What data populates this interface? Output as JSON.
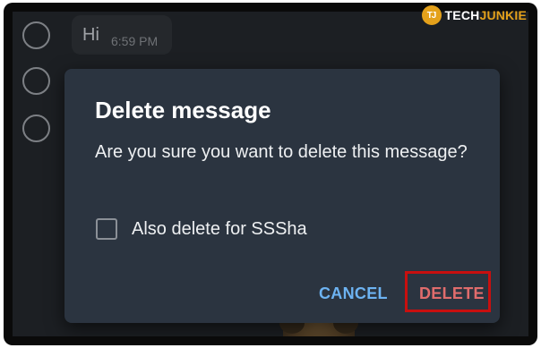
{
  "watermark": {
    "badge": "TJ",
    "brand_prefix": "TECH",
    "brand_suffix": "JUNKIE",
    "accent_color": "#e4a11b"
  },
  "chat": {
    "message_text": "Hi",
    "message_time": "6:59 PM",
    "selection_circles": 3
  },
  "dialog": {
    "title": "Delete message",
    "body": "Are you sure you want to delete this message?",
    "checkbox_label": "Also delete for SSSha",
    "checkbox_checked": false,
    "cancel_label": "CANCEL",
    "delete_label": "DELETE",
    "colors": {
      "background": "#2b3440",
      "cancel": "#6db3f2",
      "delete": "#e06c6c",
      "highlight": "#c80f0f"
    }
  }
}
